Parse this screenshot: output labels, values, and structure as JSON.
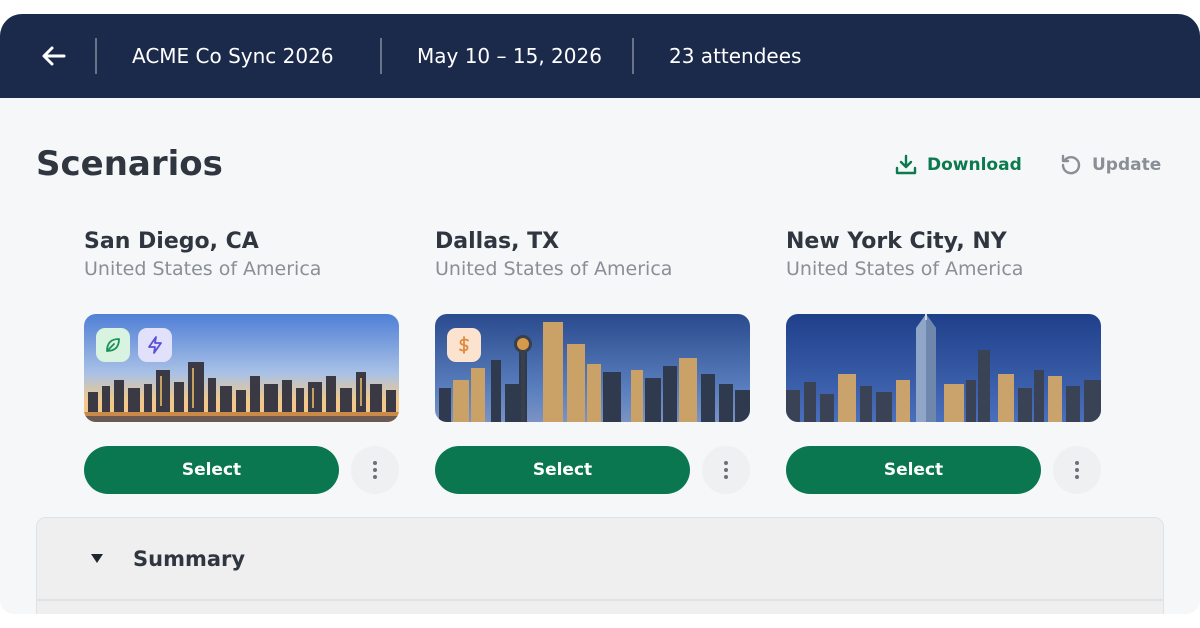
{
  "header": {
    "event_name": "ACME Co Sync 2026",
    "dates": "May 10 – 15, 2026",
    "attendees": "23 attendees"
  },
  "page": {
    "title": "Scenarios",
    "actions": {
      "download_label": "Download",
      "update_label": "Update"
    }
  },
  "scenarios": [
    {
      "city": "San Diego, CA",
      "country": "United States of America",
      "badges": [
        "leaf-icon",
        "lightning-icon"
      ],
      "select_label": "Select"
    },
    {
      "city": "Dallas, TX",
      "country": "United States of America",
      "badges": [
        "dollar-icon"
      ],
      "select_label": "Select"
    },
    {
      "city": "New York City, NY",
      "country": "United States of America",
      "badges": [],
      "select_label": "Select"
    }
  ],
  "summary": {
    "label": "Summary",
    "expanded": true
  },
  "colors": {
    "header_bg": "#1b2a4a",
    "primary": "#0b7750",
    "download": "#0c7a4e",
    "muted": "#8a8f96"
  }
}
